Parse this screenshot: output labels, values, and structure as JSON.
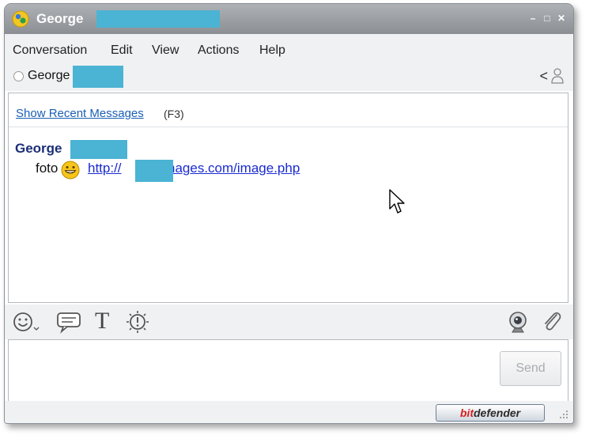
{
  "window": {
    "title": "George",
    "controls": {
      "minimize": "–",
      "maximize": "□",
      "close": "✕"
    }
  },
  "menu": [
    "Conversation",
    "Edit",
    "View",
    "Actions",
    "Help"
  ],
  "contact": {
    "name": "George",
    "collapse_glyph": "<"
  },
  "history": {
    "recent_link": "Show Recent Messages",
    "recent_shortcut": "(F3)",
    "messages": [
      {
        "sender": "George",
        "text": "foto",
        "link_prefix": "http://",
        "link_suffix": "images.com/image.php"
      }
    ]
  },
  "toolbar": {
    "format_glyph": "T",
    "icons": [
      "smiley-icon",
      "speech-bubble-icon",
      "text-format-icon",
      "nudge-icon",
      "webcam-icon",
      "paperclip-icon"
    ]
  },
  "input": {
    "value": "",
    "send_label": "Send"
  },
  "footer": {
    "brand_left": "bit",
    "brand_right": "defender"
  },
  "colors": {
    "titlebar": "#9a9ea3",
    "redaction": "#4bb3d3",
    "link": "#1a5fb4",
    "sender": "#1c2e78"
  }
}
